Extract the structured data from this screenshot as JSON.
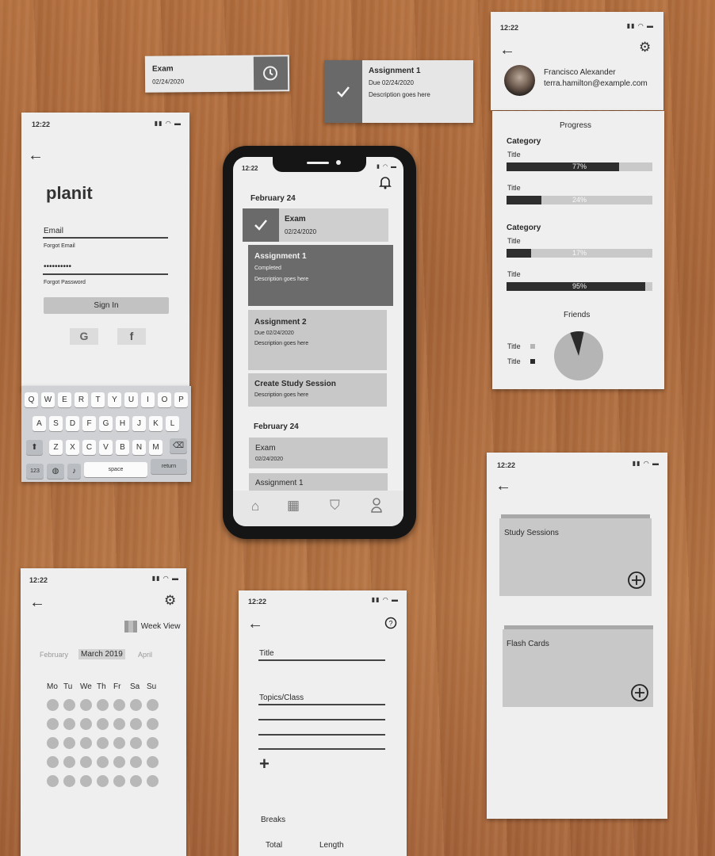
{
  "exam_snippet": {
    "title": "Exam",
    "date": "02/24/2020",
    "icon": "clock-icon"
  },
  "assignment_snippet": {
    "title": "Assignment 1",
    "due": "Due 02/24/2020",
    "description": "Description goes here",
    "icon": "check-icon"
  },
  "login": {
    "time": "12:22",
    "logo": "planit",
    "email_label": "Email",
    "forgot_email": "Forgot Email",
    "password_mask": "••••••••••",
    "forgot_password": "Forgot Password",
    "signin_label": "Sign In",
    "google_label": "G",
    "facebook_label": "f",
    "keyboard": {
      "row1": [
        "Q",
        "W",
        "E",
        "R",
        "T",
        "Y",
        "U",
        "I",
        "O",
        "P"
      ],
      "row2": [
        "A",
        "S",
        "D",
        "F",
        "G",
        "H",
        "J",
        "K",
        "L"
      ],
      "row3": [
        "Z",
        "X",
        "C",
        "V",
        "B",
        "N",
        "M"
      ],
      "numbers": "123",
      "space": "space",
      "return": "return"
    }
  },
  "main_phone": {
    "time": "12:22",
    "date_header_1": "February 24",
    "exam": {
      "title": "Exam",
      "date": "02/24/2020"
    },
    "assignment1": {
      "title": "Assignment 1",
      "status": "Completed",
      "description": "Description goes here"
    },
    "assignment2": {
      "title": "Assignment 2",
      "due": "Due 02/24/2020",
      "description": "Description goes here"
    },
    "study_session": {
      "title": "Create Study Session",
      "description": "Description goes here"
    },
    "date_header_2": "February 24",
    "exam2": {
      "title": "Exam",
      "date": "02/24/2020"
    },
    "assignment_peek": "Assignment 1"
  },
  "profile": {
    "time": "12:22",
    "name": "Francisco Alexander",
    "email": "terra.hamilton@example.com",
    "progress_heading": "Progress",
    "categories": [
      {
        "name": "Category",
        "items": [
          {
            "title": "Title",
            "percent": 77,
            "label": "77%"
          },
          {
            "title": "Title",
            "percent": 24,
            "label": "24%"
          }
        ]
      },
      {
        "name": "Category",
        "items": [
          {
            "title": "Title",
            "percent": 17,
            "label": "17%"
          },
          {
            "title": "Title",
            "percent": 95,
            "label": "95%"
          }
        ]
      }
    ],
    "friends_heading": "Friends",
    "friends_legend": [
      {
        "title": "Title",
        "color": "#b5b5b5"
      },
      {
        "title": "Title",
        "color": "#2b2b2b"
      }
    ],
    "friends_pie_dark_fraction": 0.09
  },
  "study": {
    "time": "12:22",
    "sessions_label": "Study Sessions",
    "flashcards_label": "Flash Cards"
  },
  "calendar": {
    "time": "12:22",
    "week_view": "Week View",
    "months": [
      "February",
      "March 2019",
      "April"
    ],
    "weekdays": [
      "Mo",
      "Tu",
      "We",
      "Th",
      "Fr",
      "Sa",
      "Su"
    ]
  },
  "session_form": {
    "time": "12:22",
    "title_label": "Title",
    "topics_label": "Topics/Class",
    "breaks_label": "Breaks",
    "total_label": "Total",
    "length_label": "Length"
  }
}
